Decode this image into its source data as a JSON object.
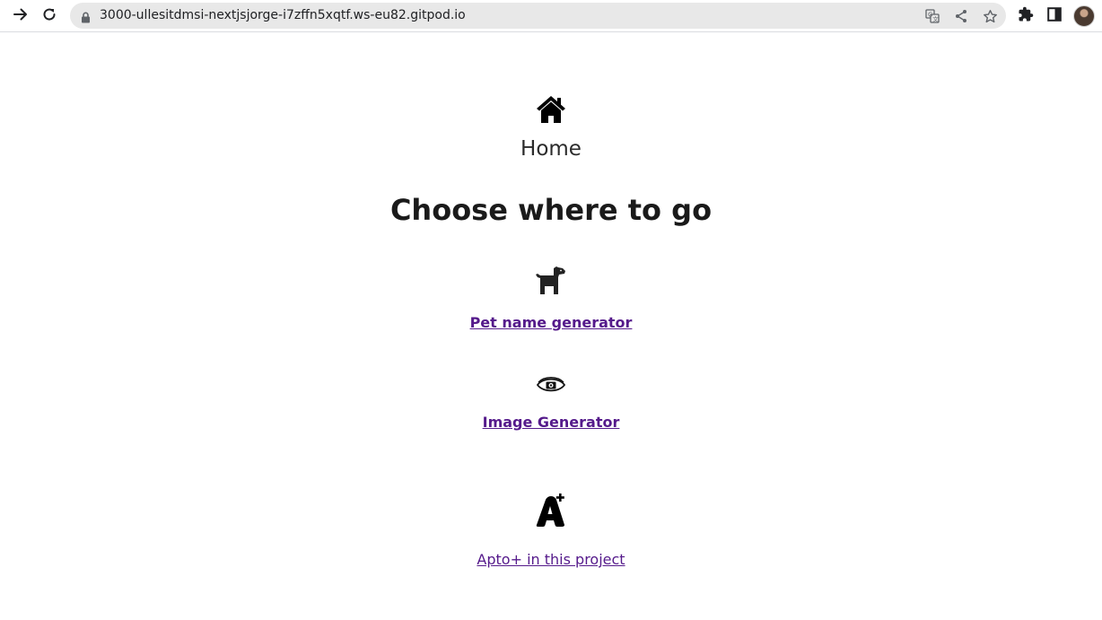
{
  "browser": {
    "url": "3000-ullesitdmsi-nextjsjorge-i7zffn5xqtf.ws-eu82.gitpod.io",
    "icons": {
      "forward": "arrow-right-icon",
      "reload": "reload-icon",
      "lock": "lock-icon",
      "translate": "translate-icon",
      "share": "share-icon",
      "bookmark": "star-icon",
      "extensions": "puzzle-icon",
      "side_panel": "side-panel-icon",
      "profile": "avatar"
    }
  },
  "page": {
    "home_icon": "home-icon",
    "home_label": "Home",
    "heading": "Choose where to go",
    "links": [
      {
        "icon": "dog-icon",
        "label": "Pet name generator"
      },
      {
        "icon": "eye-icon",
        "label": "Image Generator"
      },
      {
        "icon": "font-plus-icon",
        "label": "Apto+ in this project"
      }
    ],
    "colors": {
      "link": "#551a8b",
      "text": "#1a1a1a"
    }
  }
}
